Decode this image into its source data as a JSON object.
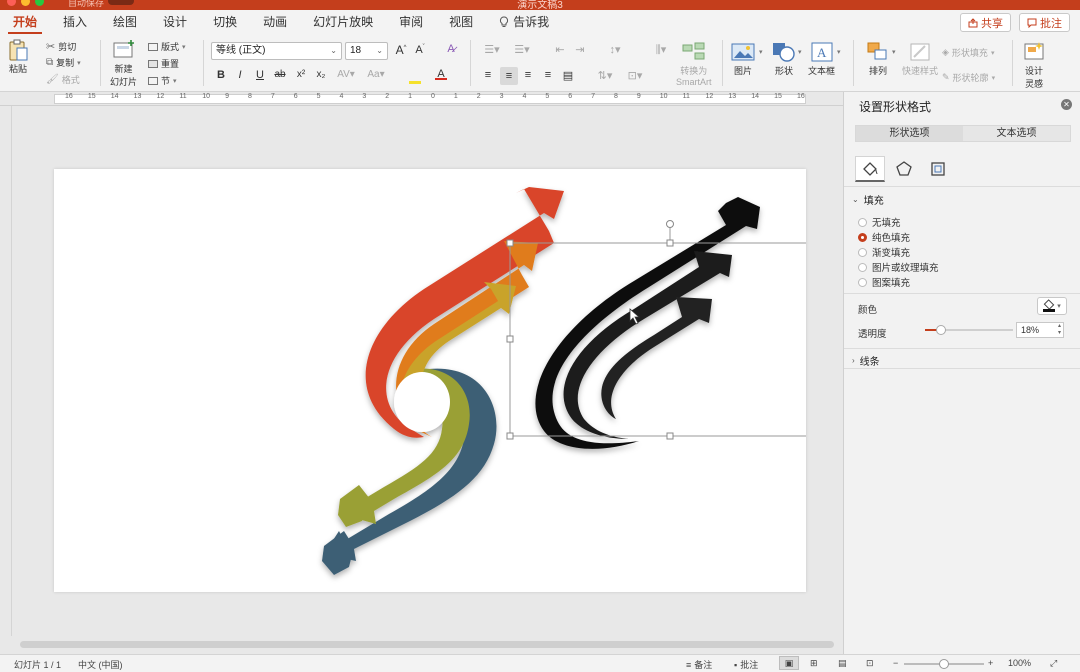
{
  "window": {
    "title": "演示文稿3",
    "autosave_label": "自动保存"
  },
  "tabs": [
    {
      "label": "开始",
      "active": true
    },
    {
      "label": "插入"
    },
    {
      "label": "绘图"
    },
    {
      "label": "设计"
    },
    {
      "label": "切换"
    },
    {
      "label": "动画"
    },
    {
      "label": "幻灯片放映"
    },
    {
      "label": "审阅"
    },
    {
      "label": "视图"
    },
    {
      "label": "告诉我"
    }
  ],
  "share": {
    "label": "共享"
  },
  "comments_btn": {
    "label": "批注"
  },
  "ribbon": {
    "paste": "粘贴",
    "cut": "剪切",
    "copy": "复制",
    "format_painter": "格式",
    "new_slide_line1": "新建",
    "new_slide_line2": "幻灯片",
    "layout": "版式",
    "reset": "重置",
    "section": "节",
    "font_name": "等线 (正文)",
    "font_size": "18",
    "bold": "B",
    "italic": "I",
    "underline": "U",
    "strike": "ab",
    "superscript": "x²",
    "subscript": "x₂",
    "convert_smartart_line1": "转换为",
    "convert_smartart_line2": "SmartArt",
    "picture": "图片",
    "shape": "形状",
    "textbox": "文本框",
    "arrange": "排列",
    "quick_styles": "快速样式",
    "shape_fill": "形状填充",
    "shape_outline": "形状轮廓",
    "design_ideas_line1": "设计",
    "design_ideas_line2": "灵感"
  },
  "ruler": {
    "numbers": [
      "16",
      "15",
      "14",
      "13",
      "12",
      "11",
      "10",
      "9",
      "8",
      "7",
      "6",
      "5",
      "4",
      "3",
      "2",
      "1",
      "0",
      "1",
      "2",
      "3",
      "4",
      "5",
      "6",
      "7",
      "8",
      "9",
      "10",
      "11",
      "12",
      "13",
      "14",
      "15",
      "16"
    ]
  },
  "panel": {
    "title": "设置形状格式",
    "tab_shape": "形状选项",
    "tab_text": "文本选项",
    "fill_section": "填充",
    "fill_options": [
      {
        "label": "无填充",
        "selected": false
      },
      {
        "label": "纯色填充",
        "selected": true
      },
      {
        "label": "渐变填充",
        "selected": false
      },
      {
        "label": "图片或纹理填充",
        "selected": false
      },
      {
        "label": "图案填充",
        "selected": false
      }
    ],
    "color_label": "颜色",
    "transparency_label": "透明度",
    "transparency_value": "18%",
    "transparency_level": 0.18,
    "line_section": "线条"
  },
  "status": {
    "slide_info": "幻灯片 1 / 1",
    "language": "中文 (中国)",
    "notes": "备注",
    "comments": "批注",
    "zoom_minus": "−",
    "zoom_plus": "+",
    "zoom": "100%"
  },
  "colors": {
    "accent": "#c43e1c",
    "arrow_red": "#d9452a",
    "arrow_orange": "#e07b1e",
    "arrow_yellow": "#c9a32a",
    "arrow_olive": "#9aa035",
    "arrow_blue": "#3d5f75",
    "black_shape": "#111111"
  }
}
